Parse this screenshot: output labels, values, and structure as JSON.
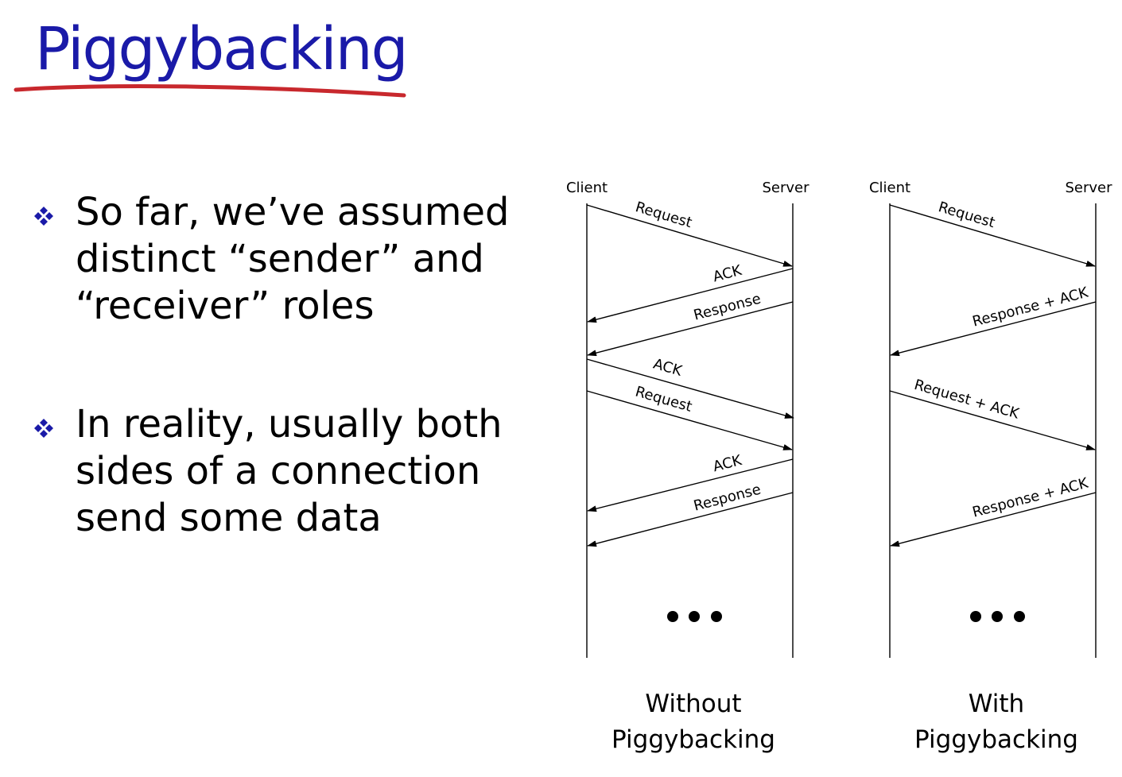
{
  "title": "Piggybacking",
  "bullets": [
    {
      "text": "So far, we’ve assumed distinct “sender” and “receiver” roles",
      "icon": "diamond-cluster-bullet-icon"
    },
    {
      "text": "In reality, usually both sides of a connection send some data",
      "icon": "diamond-cluster-bullet-icon"
    }
  ],
  "diagrams": {
    "without": {
      "client_label": "Client",
      "server_label": "Server",
      "messages": [
        "Request",
        "ACK",
        "Response",
        "ACK",
        "Request",
        "ACK",
        "Response"
      ],
      "ellipsis": "• • •",
      "caption_line1": "Without",
      "caption_line2": "Piggybacking"
    },
    "with": {
      "client_label": "Client",
      "server_label": "Server",
      "messages": [
        "Request",
        "Response + ACK",
        "Request + ACK",
        "Response + ACK"
      ],
      "ellipsis": "• • •",
      "caption_line1": "With",
      "caption_line2": "Piggybacking"
    }
  },
  "colors": {
    "title": "#1a1aa8",
    "underline": "#c8282d",
    "bullet_icon": "#1a1aa8"
  }
}
